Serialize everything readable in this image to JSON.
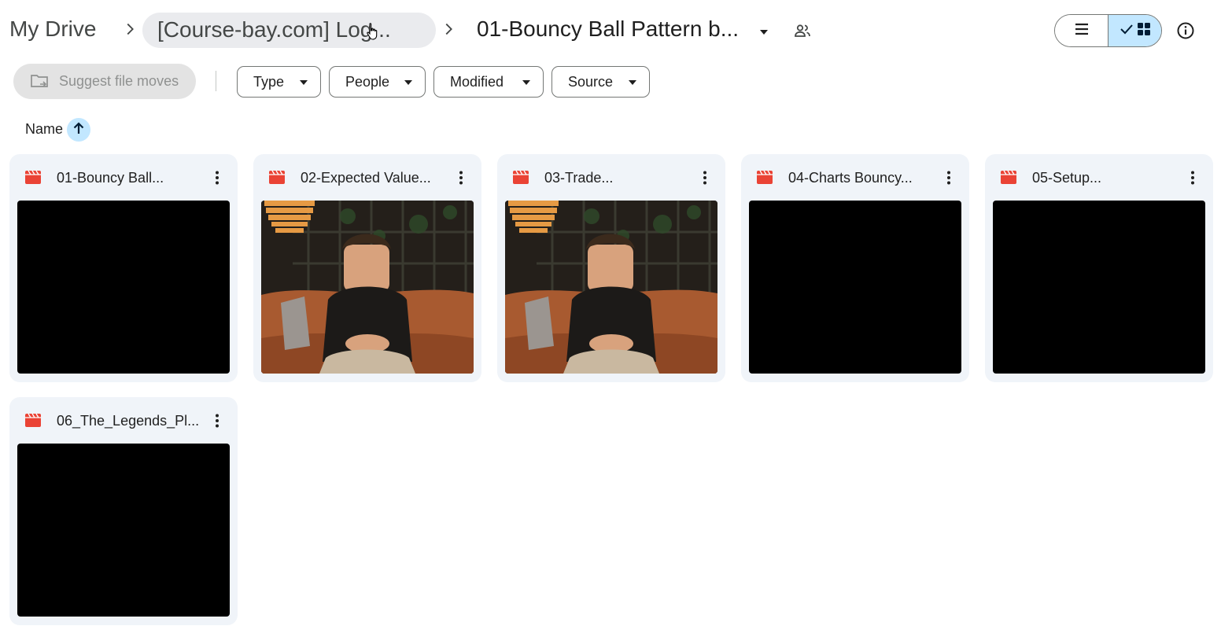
{
  "breadcrumb": {
    "root": "My Drive",
    "parent": "[Course-bay.com] Log...",
    "current": "01-Bouncy Ball Pattern b..."
  },
  "icons": {
    "chevron": "chevron-right-icon",
    "shared": "shared-people-icon",
    "view_list": "list-view-icon",
    "view_grid": "grid-view-icon",
    "info": "info-icon",
    "file_type": "video-file-icon",
    "more": "more-vert-icon",
    "sort": "arrow-up-icon"
  },
  "view_mode": "grid",
  "toolbar": {
    "suggest_label": "Suggest file moves",
    "filters": [
      "Type",
      "People",
      "Modified",
      "Source"
    ]
  },
  "sort": {
    "label": "Name",
    "direction": "ascending"
  },
  "colors": {
    "accent": "#c2e7ff",
    "video_icon": "#ea4335",
    "card_bg": "#f0f4f9"
  },
  "files": [
    {
      "name": "01-Bouncy Ball...",
      "thumbnail": "black"
    },
    {
      "name": "02-Expected Value...",
      "thumbnail": "presenter-on-couch"
    },
    {
      "name": "03-Trade...",
      "thumbnail": "presenter-on-couch"
    },
    {
      "name": "04-Charts Bouncy...",
      "thumbnail": "black"
    },
    {
      "name": "05-Setup...",
      "thumbnail": "black"
    },
    {
      "name": "06_The_Legends_Pl...",
      "thumbnail": "black"
    }
  ]
}
